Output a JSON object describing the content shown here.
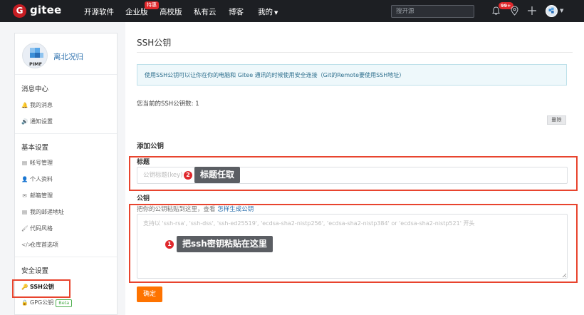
{
  "nav": {
    "logo_letter": "G",
    "logo_text": "gitee",
    "items": [
      "开源软件",
      "企业版",
      "高校版",
      "私有云",
      "博客",
      "我的"
    ],
    "hot_badge": "特惠",
    "search_placeholder": "搜开源",
    "notification_count": "99+",
    "icons": [
      "bell-icon",
      "location-icon",
      "plus-icon"
    ]
  },
  "sidebar": {
    "username": "离北况归",
    "avatar_text": "PIMF",
    "sections": [
      {
        "title": "消息中心",
        "items": [
          {
            "icon": "bell-icon",
            "glyph": "🔔",
            "label": "我的消息"
          },
          {
            "icon": "speaker-icon",
            "glyph": "🔊",
            "label": "通知设置"
          }
        ]
      },
      {
        "title": "基本设置",
        "items": [
          {
            "icon": "id-card-icon",
            "glyph": "▤",
            "label": "帐号管理"
          },
          {
            "icon": "user-icon",
            "glyph": "👤",
            "label": "个人资料"
          },
          {
            "icon": "envelope-icon",
            "glyph": "✉",
            "label": "邮箱管理"
          },
          {
            "icon": "id-card-icon",
            "glyph": "▤",
            "label": "我的邮递地址"
          },
          {
            "icon": "brush-icon",
            "glyph": "🖌",
            "label": "代码风格"
          },
          {
            "icon": "code-icon",
            "glyph": "</>",
            "label": "仓库首选项"
          }
        ]
      },
      {
        "title": "安全设置",
        "items": [
          {
            "icon": "key-icon",
            "glyph": "🔑",
            "label": "SSH公钥"
          },
          {
            "icon": "lock-icon",
            "glyph": "🔒",
            "label": "GPG公钥"
          }
        ]
      }
    ],
    "beta_badge": "Beta"
  },
  "main": {
    "title": "SSH公钥",
    "info": "使用SSH公钥可以让你在你的电脑和 Gitee 通讯的时候使用安全连接（Git的Remote要使用SSH地址）",
    "count_label": "您当前的SSH公钥数: 1",
    "delete_label": "删除",
    "add_title": "添加公钥",
    "title_label": "标题",
    "title_placeholder": "公钥标题(key)",
    "key_label": "公钥",
    "key_hint": "把你的公钥粘贴到这里，查看",
    "key_hint_link": "怎样生成公钥",
    "key_placeholder": "支持以 'ssh-rsa', 'ssh-dss', 'ssh-ed25519', 'ecdsa-sha2-nistp256', 'ecdsa-sha2-nistp384' or 'ecdsa-sha2-nistp521' 开头",
    "confirm_label": "确定"
  },
  "annotations": {
    "one": {
      "num": "1",
      "text": "把ssh密钥粘贴在这里"
    },
    "two": {
      "num": "2",
      "text": "标题任取"
    }
  },
  "colors": {
    "nav_bg": "#1d1f23",
    "brand_red": "#c71d23",
    "confirm_orange": "#fe7300",
    "annotation_red": "#e8442e",
    "link_blue": "#2b6fad"
  }
}
